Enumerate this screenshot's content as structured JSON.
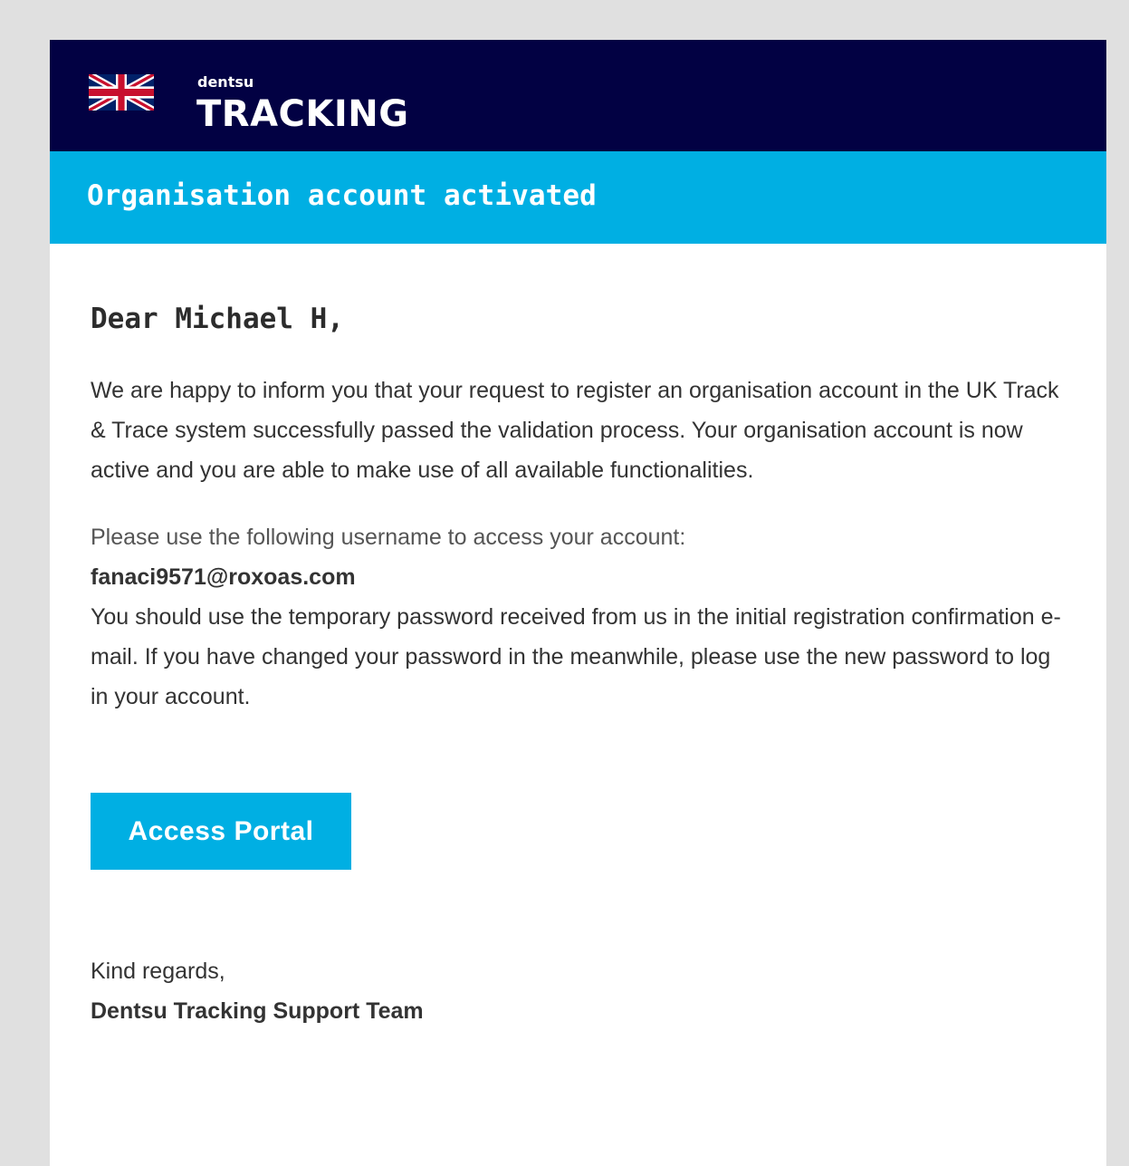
{
  "header": {
    "brand_prefix": "dentsu",
    "brand_name": "TRACKING",
    "logo": "uk-flag-icon",
    "background_color": "#020143"
  },
  "banner": {
    "title": "Organisation account activated",
    "background_color": "#00afe3"
  },
  "message": {
    "greeting": "Dear Michael H,",
    "intro": "We are happy to inform you that your request to register an organisation account in the UK Track & Trace system successfully passed the validation process. Your organisation account is now active and you are able to make use of all available functionalities.",
    "username_prompt": "Please use the following username to access your account:",
    "username": "fanaci9571@roxoas.com",
    "password_note": "You should use the temporary password received from us in the initial registration confirmation e-mail. If you have changed your password in the meanwhile, please use the new password to log in your account."
  },
  "cta": {
    "label": "Access Portal",
    "color": "#00afe3"
  },
  "signoff": {
    "closing": "Kind regards,",
    "team": "Dentsu Tracking Support Team"
  }
}
